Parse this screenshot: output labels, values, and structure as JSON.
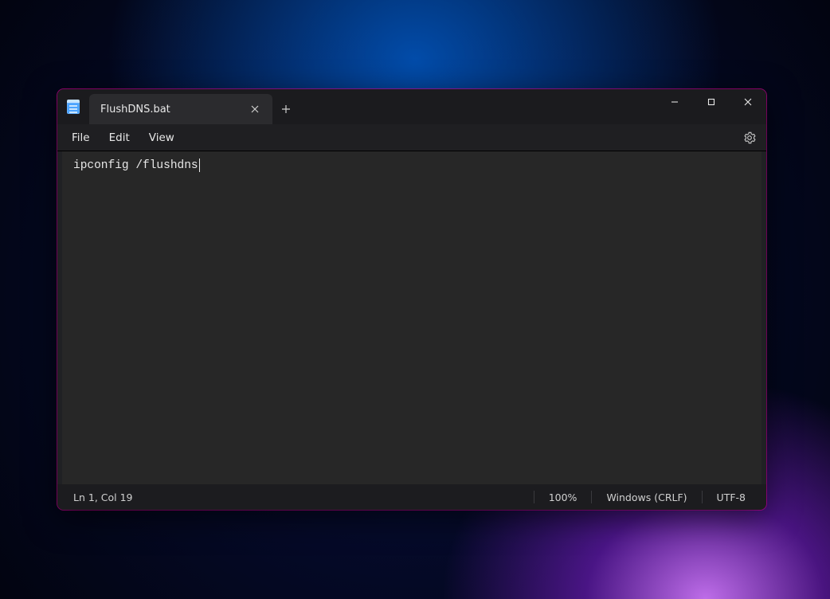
{
  "tab": {
    "title": "FlushDNS.bat"
  },
  "menu": {
    "file": "File",
    "edit": "Edit",
    "view": "View"
  },
  "editor": {
    "content": "ipconfig /flushdns"
  },
  "status": {
    "position": "Ln 1, Col 19",
    "zoom": "100%",
    "lineEnding": "Windows (CRLF)",
    "encoding": "UTF-8"
  }
}
